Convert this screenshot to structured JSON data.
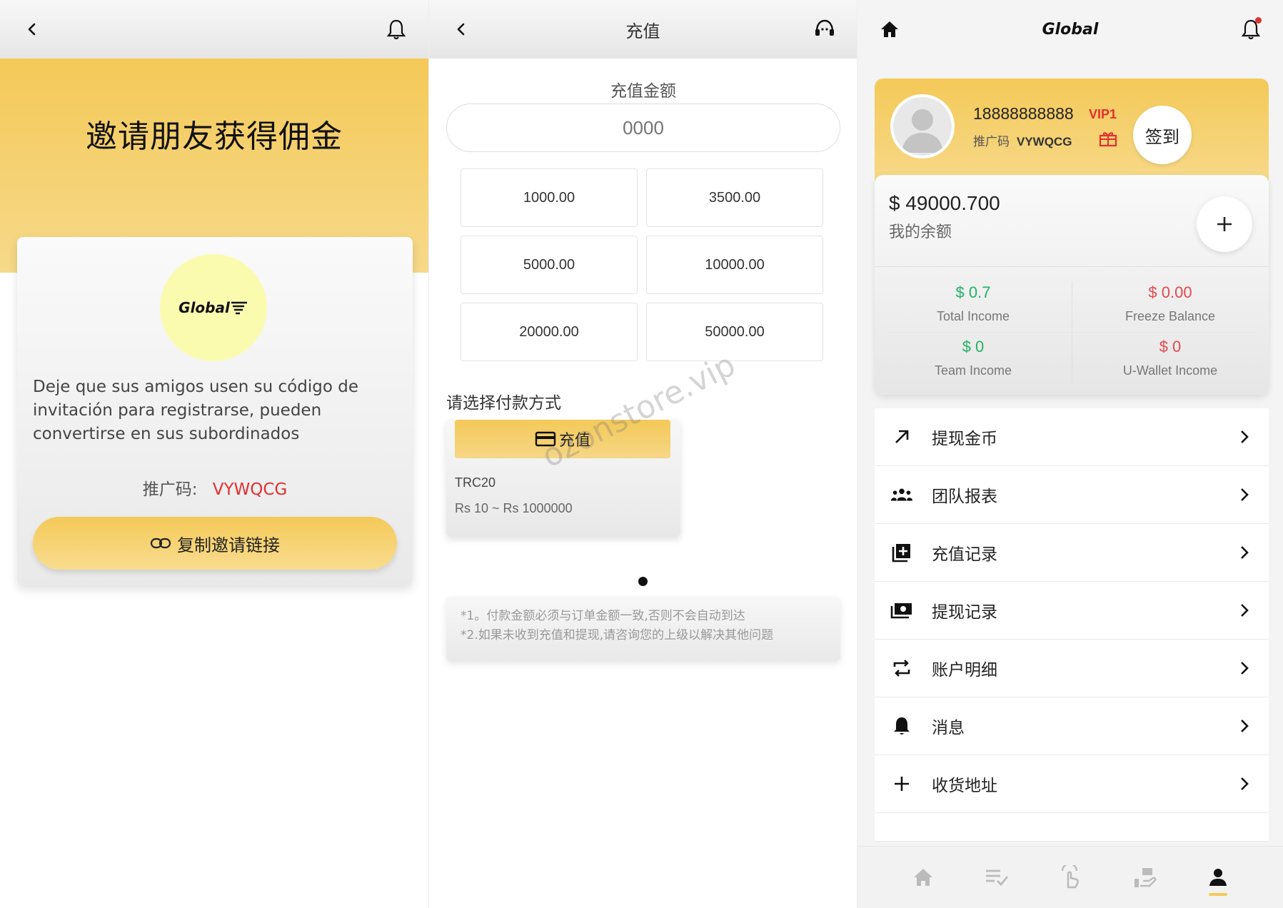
{
  "invite": {
    "heading": "邀请朋友获得佣金",
    "logo_text": "Global",
    "description": "Deje que sus amigos usen su código de invitación para registrarse, pueden convertirse en sus subordinados",
    "promo_label": "推广码:",
    "promo_code": "VYWQCG",
    "copy_button": "复制邀请链接"
  },
  "recharge": {
    "title": "充值",
    "amount_label": "充值金额",
    "amount_placeholder": "0000",
    "presets": [
      "1000.00",
      "3500.00",
      "5000.00",
      "10000.00",
      "20000.00",
      "50000.00"
    ],
    "pay_method_label": "请选择付款方式",
    "pay_button": "充值",
    "pay_name": "TRC20",
    "pay_range": "Rs 10 ~ Rs 1000000",
    "watermark": "ozonstore.vip",
    "note1": "*1。付款金额必须与订单金额一致,否则不会自动到达",
    "note2": "*2.如果未收到充值和提现,请咨询您的上级以解决其他问题"
  },
  "account": {
    "brand": "Global",
    "phone": "18888888888",
    "vip": "VIP1",
    "promo_label": "推广码",
    "promo_code": "VYWQCG",
    "signin": "签到",
    "balance": "$ 49000.700",
    "balance_label": "我的余额",
    "stats": [
      {
        "value": "$ 0.7",
        "label": "Total Income",
        "color": "green"
      },
      {
        "value": "$ 0.00",
        "label": "Freeze Balance",
        "color": "red"
      },
      {
        "value": "$ 0",
        "label": "Team Income",
        "color": "green"
      },
      {
        "value": "$ 0",
        "label": "U-Wallet Income",
        "color": "red"
      }
    ],
    "menu": [
      {
        "label": "提现金币",
        "icon": "arrow-up-right-icon"
      },
      {
        "label": "团队报表",
        "icon": "team-icon"
      },
      {
        "label": "充值记录",
        "icon": "add-box-icon"
      },
      {
        "label": "提现记录",
        "icon": "cash-icon"
      },
      {
        "label": "账户明细",
        "icon": "swap-icon"
      },
      {
        "label": "消息",
        "icon": "bell-icon"
      },
      {
        "label": "收货地址",
        "icon": "plus-icon"
      }
    ],
    "tabs": [
      "home-icon",
      "orders-icon",
      "grab-icon",
      "money-icon",
      "profile-icon"
    ]
  },
  "colors": {
    "accent": "#f4c958",
    "accent_light": "#f6d98a",
    "green": "#20b365",
    "red": "#e03131"
  }
}
